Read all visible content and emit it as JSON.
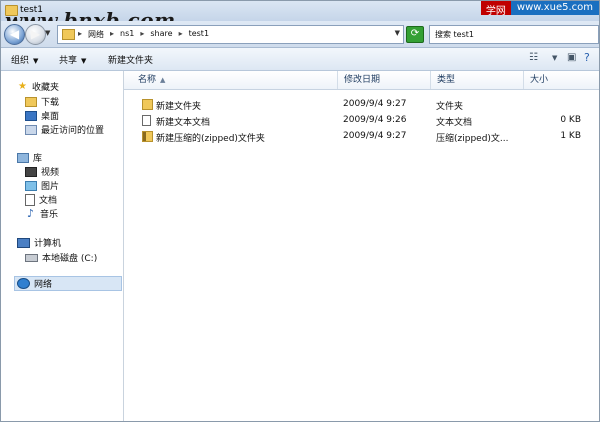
{
  "watermarks": {
    "left": "www.bnxb.com",
    "right_a": "学网",
    "right_b": "www.xue5.com"
  },
  "window": {
    "title": "test1"
  },
  "address": {
    "crumbs": [
      "网络",
      "ns1",
      "share",
      "test1"
    ],
    "separator": "▸",
    "search_text": "搜索 test1"
  },
  "toolbar": {
    "organize": "组织",
    "share": "共享",
    "new_folder": "新建文件夹"
  },
  "nav": {
    "favorites": "收藏夹",
    "downloads": "下载",
    "desktop": "桌面",
    "recent": "最近访问的位置",
    "libraries": "库",
    "videos": "视频",
    "pictures": "图片",
    "documents": "文档",
    "music": "音乐",
    "computer": "计算机",
    "local_disk": "本地磁盘 (C:)",
    "network": "网络"
  },
  "columns": {
    "name": "名称",
    "date": "修改日期",
    "type": "类型",
    "size": "大小"
  },
  "files": [
    {
      "name": "新建文件夹",
      "date": "2009/9/4 9:27",
      "type": "文件夹",
      "size": "",
      "icon": "folder-icon"
    },
    {
      "name": "新建文本文档",
      "date": "2009/9/4 9:26",
      "type": "文本文档",
      "size": "0 KB",
      "icon": "text-file-icon"
    },
    {
      "name": "新建压缩的(zipped)文件夹",
      "date": "2009/9/4 9:27",
      "type": "压缩(zipped)文...",
      "size": "1 KB",
      "icon": "zip-folder-icon"
    }
  ]
}
